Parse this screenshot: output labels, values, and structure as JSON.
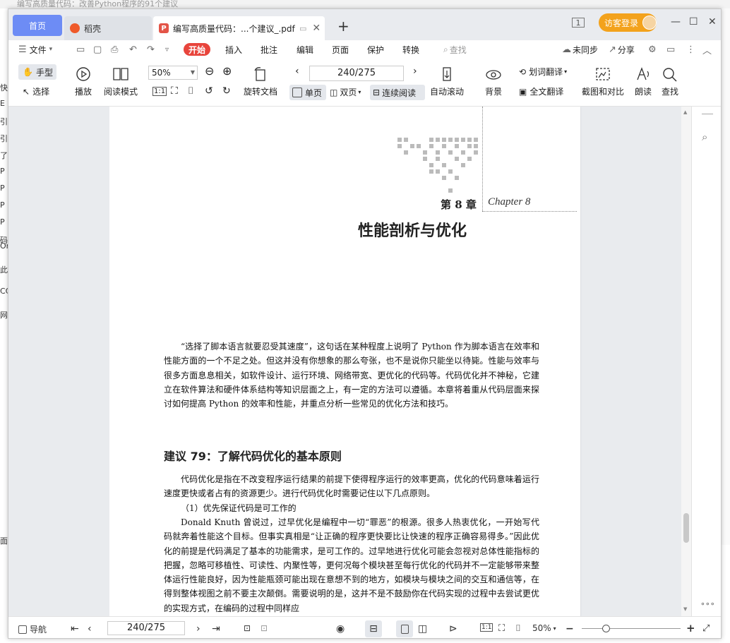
{
  "background": {
    "title_strip": "编写高质量代码：改善Python程序的91个建议",
    "side_chars": [
      "快",
      "E",
      "引",
      "引",
      "了",
      "P",
      "P",
      "P",
      "P",
      "码",
      "On",
      "此",
      "CC",
      "网",
      "面"
    ]
  },
  "tabs": {
    "home": "首页",
    "docer": "稻壳",
    "doc_title": "编写高质量代码：...个建议_.pdf",
    "add": "+"
  },
  "titlebar": {
    "window_mode": "1",
    "login": "访客登录",
    "minimize": "—",
    "maximize": "☐",
    "close": "✕"
  },
  "menu": {
    "file": "文件",
    "start": "开始",
    "insert": "插入",
    "annotate": "批注",
    "edit": "编辑",
    "page": "页面",
    "protect": "保护",
    "convert": "转换",
    "search": "查找",
    "sync": "未同步",
    "share": "分享"
  },
  "toolbar": {
    "hand": "手型",
    "select": "选择",
    "play": "播放",
    "read_mode": "阅读模式",
    "zoom": "50%",
    "rotate": "旋转文档",
    "page_indicator": "240/275",
    "single": "单页",
    "double": "双页",
    "continuous": "连续阅读",
    "auto_scroll": "自动滚动",
    "background": "背景",
    "word_translate": "划词翻译",
    "full_translate": "全文翻译",
    "screenshot": "截图和对比",
    "read_aloud": "朗读",
    "find": "查找"
  },
  "page": {
    "chapter_no": "第 8 章",
    "chapter_en": "Chapter 8",
    "chapter_title": "性能剖析与优化",
    "intro": "“选择了脚本语言就要忍受其速度”，这句话在某种程度上说明了 Python 作为脚本语言在效率和性能方面的一个不足之处。但这并没有你想象的那么夸张，也不是说你只能坐以待毙。性能与效率与很多方面息息相关，如软件设计、运行环境、网络带宽、更优化的代码等。代码优化并不神秘，它建立在软件算法和硬件体系结构等知识层面之上，有一定的方法可以遵循。本章将着重从代码层面来探讨如何提高 Python 的效率和性能，并重点分析一些常见的优化方法和技巧。",
    "section_title": "建议 79：了解代码优化的基本原则",
    "p1": "代码优化是指在不改变程序运行结果的前提下使得程序运行的效率更高，优化的代码意味着运行速度更快或者占有的资源更少。进行代码优化时需要记住以下几点原则。",
    "p2": "（1）优先保证代码是可工作的",
    "p3": "Donald Knuth 曾说过，过早优化是编程中一切“罪恶”的根源。很多人热衷优化，一开始写代码就奔着性能这个目标。但事实真相是“让正确的程序更快要比让快速的程序正确容易得多。”因此优化的前提是代码满足了基本的功能需求，是可工作的。过早地进行优化可能会忽视对总体性能指标的把握，忽略可移植性、可读性、内聚性等，更何况每个模块甚至每行优化的代码并不一定能够带来整体运行性能良好，因为性能瓶颈可能出现在意想不到的地方，如模块与模块之间的交互和通信等，在得到整体视图之前不要主次颠倒。需要说明的是，这并不是不鼓励你在代码实现的过程中去尝试更优的实现方式，在编码的过程中同样应"
  },
  "statusbar": {
    "nav": "导航",
    "page_indicator": "240/275",
    "zoom": "50%",
    "more": "∘∘∘"
  }
}
